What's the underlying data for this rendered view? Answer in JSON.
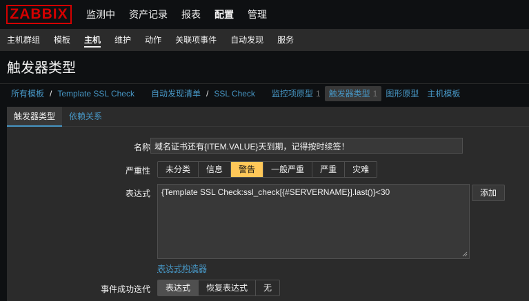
{
  "logo": "ZABBIX",
  "topnav": {
    "items": [
      {
        "label": "监测中"
      },
      {
        "label": "资产记录"
      },
      {
        "label": "报表"
      },
      {
        "label": "配置"
      },
      {
        "label": "管理"
      }
    ],
    "active": "配置"
  },
  "subnav": {
    "items": [
      {
        "label": "主机群组"
      },
      {
        "label": "模板"
      },
      {
        "label": "主机"
      },
      {
        "label": "维护"
      },
      {
        "label": "动作"
      },
      {
        "label": "关联项事件"
      },
      {
        "label": "自动发现"
      },
      {
        "label": "服务"
      }
    ],
    "active": "主机"
  },
  "page_title": "触发器类型",
  "breadcrumbs": {
    "all_templates": "所有模板",
    "template": "Template SSL Check",
    "discovery_list": "自动发现清单",
    "discovery_rule": "SSL Check",
    "item_prototypes": "监控项原型",
    "item_prototypes_count": "1",
    "trigger_prototypes": "触发器类型",
    "trigger_prototypes_count": "1",
    "graph_prototypes": "图形原型",
    "host_prototypes": "主机模板",
    "separator": "/"
  },
  "tabs": [
    {
      "label": "触发器类型"
    },
    {
      "label": "依赖关系"
    }
  ],
  "form": {
    "name_label": "名称",
    "name_value": "域名证书还有{ITEM.VALUE}天到期，记得按时续签！",
    "severity_label": "严重性",
    "severity_options": [
      "未分类",
      "信息",
      "警告",
      "一般严重",
      "严重",
      "灾难"
    ],
    "severity_selected": "警告",
    "expression_label": "表达式",
    "expression_value": "{Template SSL Check:ssl_check[{#SERVERNAME}].last()}<30",
    "add_button": "添加",
    "expression_builder_link": "表达式构造器",
    "ok_event_label": "事件成功迭代",
    "ok_event_options": [
      "表达式",
      "恢复表达式",
      "无"
    ],
    "ok_event_selected": "表达式"
  },
  "colors": {
    "brand": "#d40000",
    "link": "#4796c4",
    "warning": "#ffc859",
    "background": "#0e1012",
    "panel": "#2b2b2b"
  }
}
